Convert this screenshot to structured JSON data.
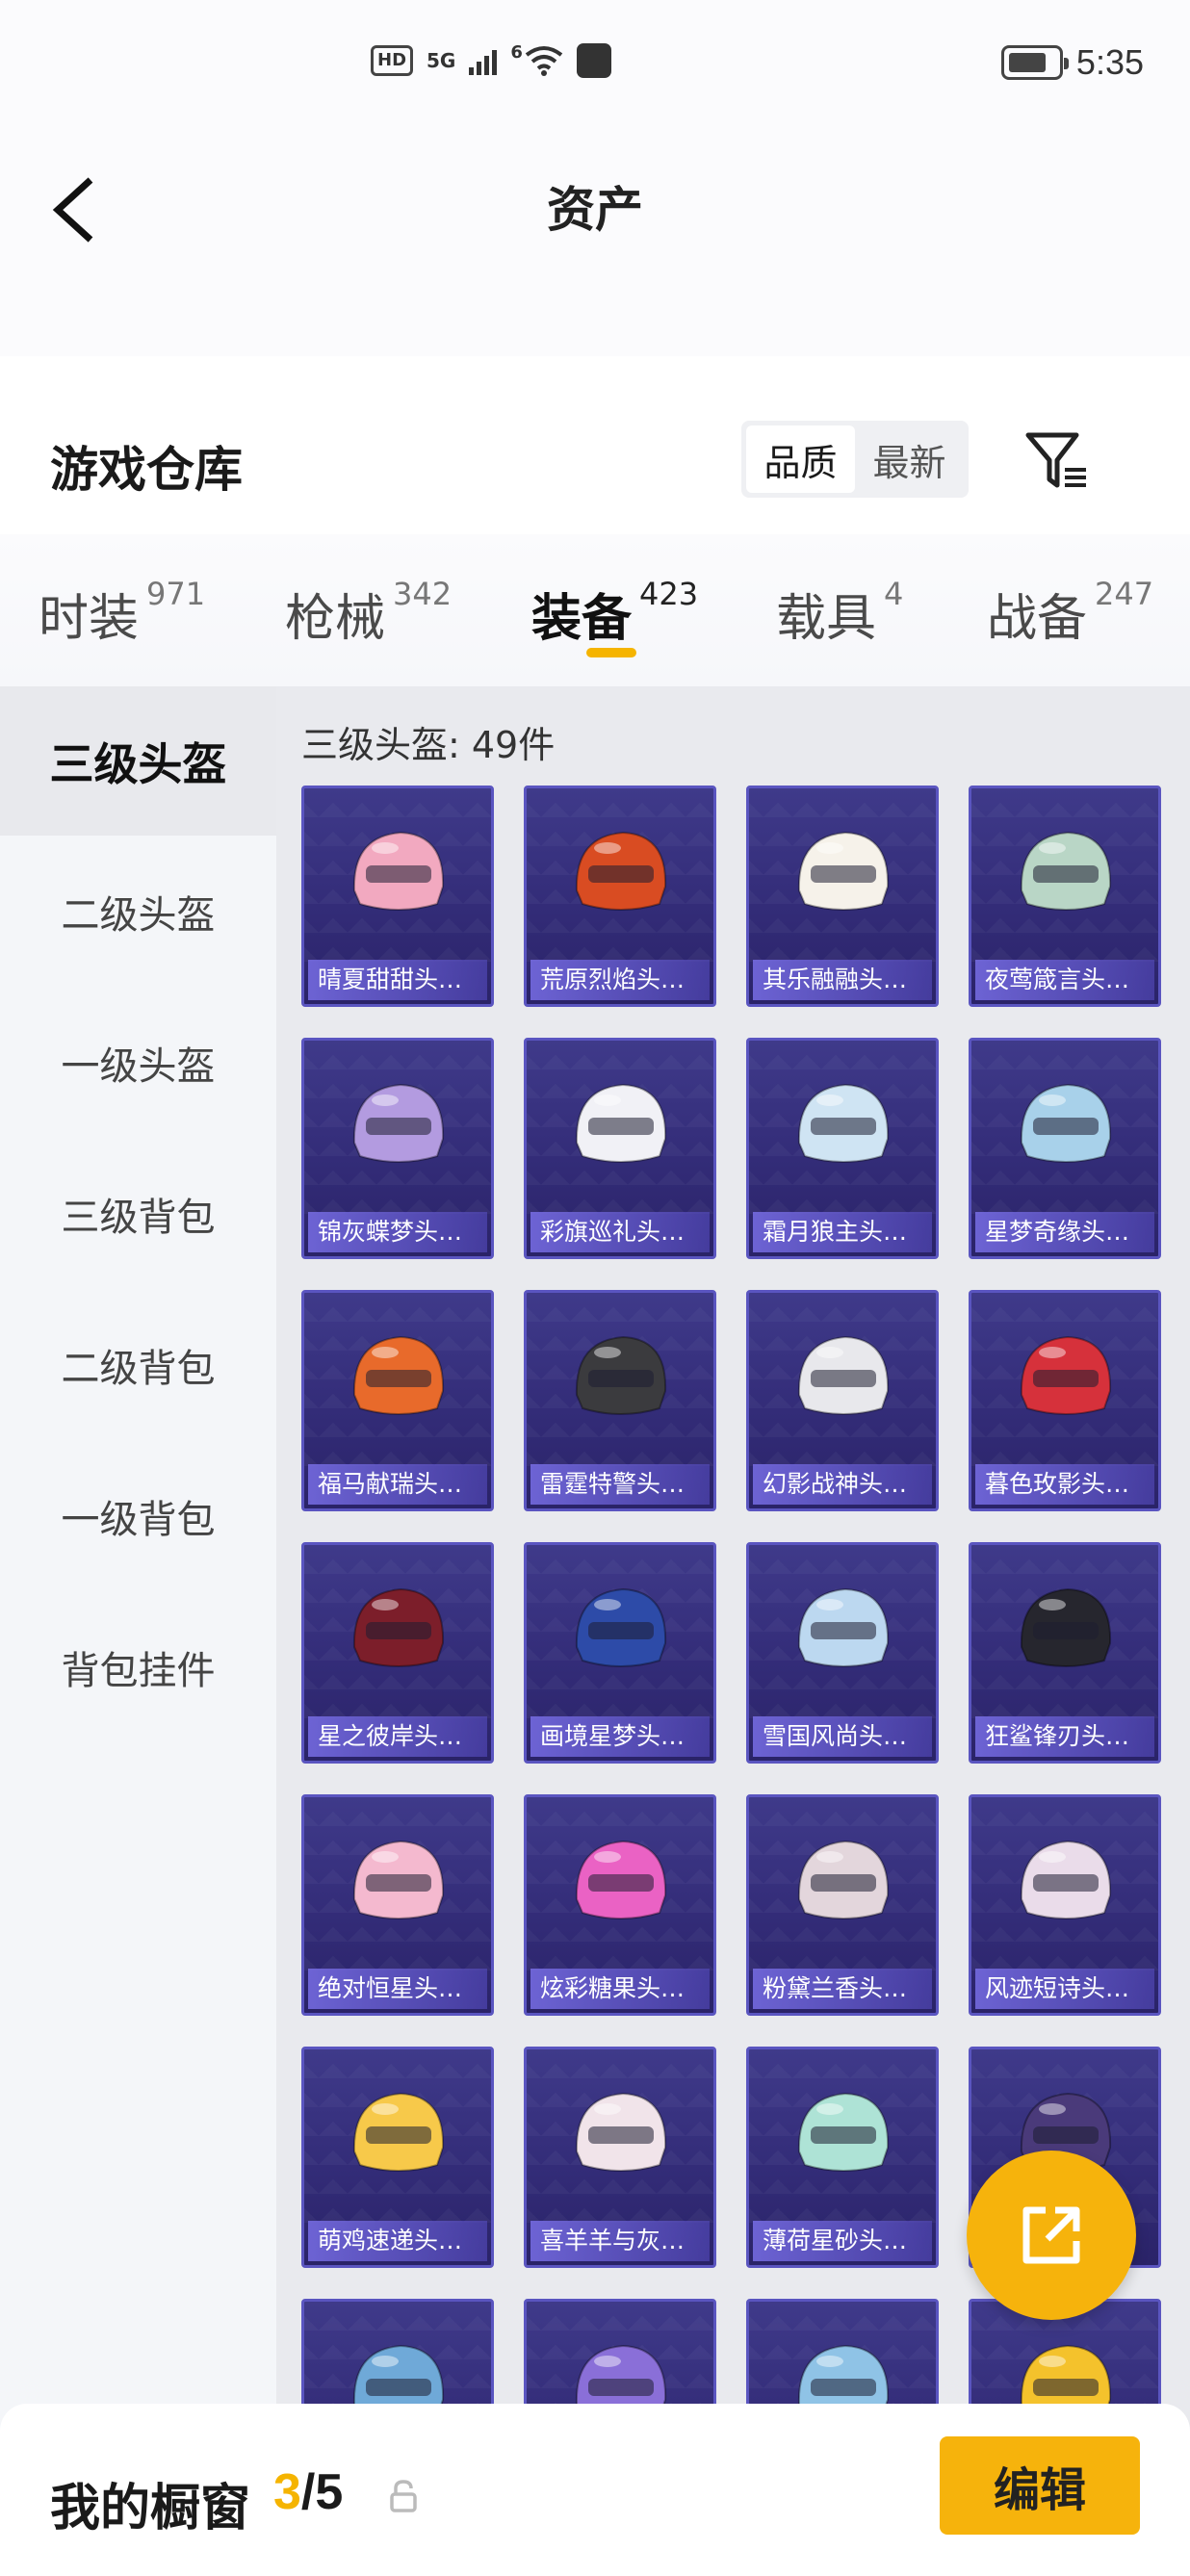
{
  "status_bar": {
    "hd": "HD",
    "network": "5G",
    "wifi_level": "6",
    "time": "5:35"
  },
  "header": {
    "title": "资产"
  },
  "warehouse": {
    "title": "游戏仓库",
    "sort_options": [
      "品质",
      "最新"
    ],
    "sort_selected": "品质"
  },
  "tabs": [
    {
      "label": "时装",
      "count": "971"
    },
    {
      "label": "枪械",
      "count": "342"
    },
    {
      "label": "装备",
      "count": "423",
      "active": true
    },
    {
      "label": "载具",
      "count": "4"
    },
    {
      "label": "战备",
      "count": "247"
    }
  ],
  "sidebar": {
    "items": [
      "三级头盔",
      "二级头盔",
      "一级头盔",
      "三级背包",
      "二级背包",
      "一级背包",
      "背包挂件"
    ],
    "selected": "三级头盔"
  },
  "content": {
    "count_line": "三级头盔: 49件",
    "items": [
      {
        "name": "晴夏甜甜头…",
        "color": "#f2a9c0"
      },
      {
        "name": "荒原烈焰头…",
        "color": "#d94c22"
      },
      {
        "name": "其乐融融头…",
        "color": "#f6f2ea"
      },
      {
        "name": "夜莺箴言头…",
        "color": "#b9d6c6"
      },
      {
        "name": "锦灰蝶梦头…",
        "color": "#b39be0"
      },
      {
        "name": "彩旗巡礼头…",
        "color": "#f1f1f6"
      },
      {
        "name": "霜月狼主头…",
        "color": "#cfe4f3"
      },
      {
        "name": "星梦奇缘头…",
        "color": "#a8d1ea"
      },
      {
        "name": "福马献瑞头…",
        "color": "#e86a2b"
      },
      {
        "name": "雷霆特警头…",
        "color": "#3b3b3e"
      },
      {
        "name": "幻影战神头…",
        "color": "#e8e8ec"
      },
      {
        "name": "暮色玫影头…",
        "color": "#d6313b"
      },
      {
        "name": "星之彼岸头…",
        "color": "#7c1e2a"
      },
      {
        "name": "画境星梦头…",
        "color": "#2d4ba8"
      },
      {
        "name": "雪国风尚头…",
        "color": "#bcd8f0"
      },
      {
        "name": "狂鲨锋刃头…",
        "color": "#26262e"
      },
      {
        "name": "绝对恒星头…",
        "color": "#f4b9cf"
      },
      {
        "name": "炫彩糖果头…",
        "color": "#ea62c4"
      },
      {
        "name": "粉黛兰香头…",
        "color": "#e3d6dc"
      },
      {
        "name": "风迹短诗头…",
        "color": "#eadcea"
      },
      {
        "name": "萌鸡速递头…",
        "color": "#f7c94a"
      },
      {
        "name": "喜羊羊与灰…",
        "color": "#f1e4ea"
      },
      {
        "name": "薄荷星砂头…",
        "color": "#aee3d6"
      },
      {
        "name": "",
        "color": "#4a3a7a"
      },
      {
        "name": "",
        "color": "#6fa9d8"
      },
      {
        "name": "",
        "color": "#8a6fd8"
      },
      {
        "name": "",
        "color": "#8fc3e6"
      },
      {
        "name": "",
        "color": "#f4c22c"
      }
    ]
  },
  "bottom_bar": {
    "label": "我的橱窗",
    "current": "3",
    "total": "/5",
    "edit_label": "编辑"
  },
  "accent_color": "#f5b400"
}
